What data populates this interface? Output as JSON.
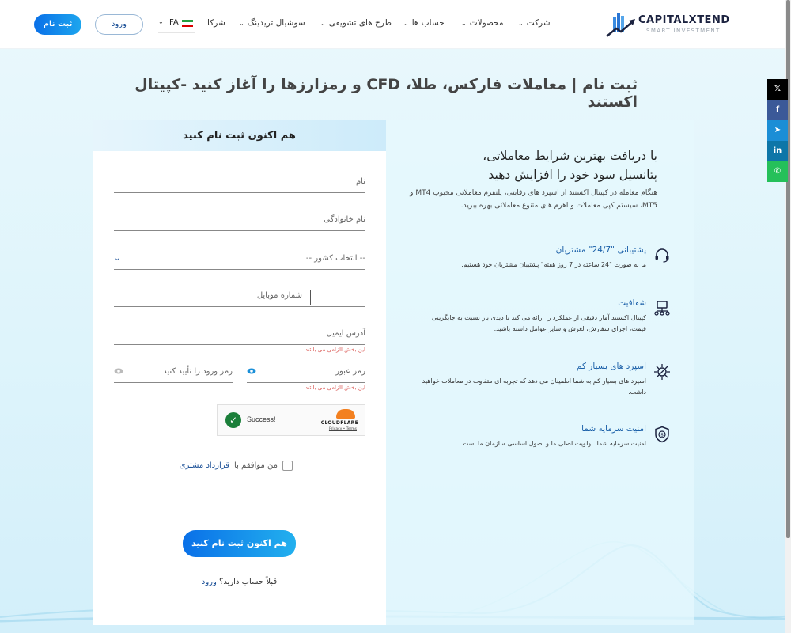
{
  "header": {
    "logo": {
      "name": "CAPITALXTEND",
      "tagline": "SMART INVESTMENT"
    },
    "nav": [
      {
        "label": "شرکت",
        "has_dropdown": true
      },
      {
        "label": "محصولات",
        "has_dropdown": true
      },
      {
        "label": "حساب ها",
        "has_dropdown": true
      },
      {
        "label": "طرح های تشویقی",
        "has_dropdown": true
      },
      {
        "label": "سوشیال تریدینگ",
        "has_dropdown": true
      },
      {
        "label": "شرکا",
        "has_dropdown": false
      }
    ],
    "language": {
      "code": "FA",
      "flag": "iran-flag-icon"
    },
    "login_label": "ورود",
    "register_label": "ثبت نام"
  },
  "page_title": "ثبت نام | معاملات فارکس، طلا، CFD و رمزارزها را آغاز کنید -کپیتال اکستند",
  "social": [
    {
      "name": "x-icon",
      "glyph": "𝕏",
      "color": "#000000"
    },
    {
      "name": "facebook-icon",
      "glyph": "f",
      "color": "#3b5998"
    },
    {
      "name": "telegram-icon",
      "glyph": "➤",
      "color": "#1b8ed6"
    },
    {
      "name": "linkedin-icon",
      "glyph": "in",
      "color": "#0e76a8"
    },
    {
      "name": "whatsapp-icon",
      "glyph": "✆",
      "color": "#25c05a"
    }
  ],
  "form": {
    "heading": "هم اکنون ثبت نام کنید",
    "first_name_placeholder": "نام",
    "last_name_placeholder": "نام خانوادگی",
    "country_placeholder": "-- انتخاب کشور --",
    "mobile_placeholder": "شماره موبایل",
    "email_placeholder": "آدرس ایمیل",
    "email_error": "این بخش الزامی می باشد",
    "password_placeholder": "رمز عبور",
    "password_error": "این بخش الزامی می باشد",
    "confirm_password_placeholder": "رمز ورود را تأیید کنید",
    "captcha": {
      "status": "Success!",
      "brand": "CLOUDFLARE",
      "links": "Privacy • Terms"
    },
    "agree_text": "من موافقم با",
    "agree_link": "قرارداد مشتری",
    "agree_checked": false,
    "submit_label": "هم اکنون ثبت نام کنید",
    "have_account_text": "قبلاً حساب دارید؟",
    "have_account_link": "ورود"
  },
  "info": {
    "title_line1": "با دریافت بهترین شرایط معاملاتی،",
    "title_line2": "پتانسیل سود خود را افزایش دهید",
    "description": "هنگام معامله در کپیتال اکستند از اسپرد های رقابتی، پلتفرم معاملاتی محبوب MT4 و MT5، سیستم کپی معاملات و اهرم های متنوع معاملاتی بهره ببرید.",
    "features": [
      {
        "icon": "headset-icon",
        "title": "پشتیبانی \"24/7\" مشتریان",
        "desc": "ما به صورت \"24 ساعته در 7 روز هفته\" پشتیبان مشتریان خود هستیم."
      },
      {
        "icon": "network-icon",
        "title": "شفافیت",
        "desc": "کپیتال اکستند آمار دقیقی از عملکرد را ارائه می کند تا دیدی باز نسبت به جایگزینی قیمت، اجرای سفارش، لغزش و سایر عوامل داشته باشید."
      },
      {
        "icon": "spread-icon",
        "title": "اسپرد های بسیار کم",
        "desc": "اسپرد های بسیار کم به شما اطمینان می دهد که تجربه ای متفاوت در معاملات خواهید داشت."
      },
      {
        "icon": "shield-dollar-icon",
        "title": "امنیت سرمایه شما",
        "desc": "امنیت سرمایه شما، اولویت اصلی ما و اصول اساسی سازمان ما است."
      }
    ]
  }
}
